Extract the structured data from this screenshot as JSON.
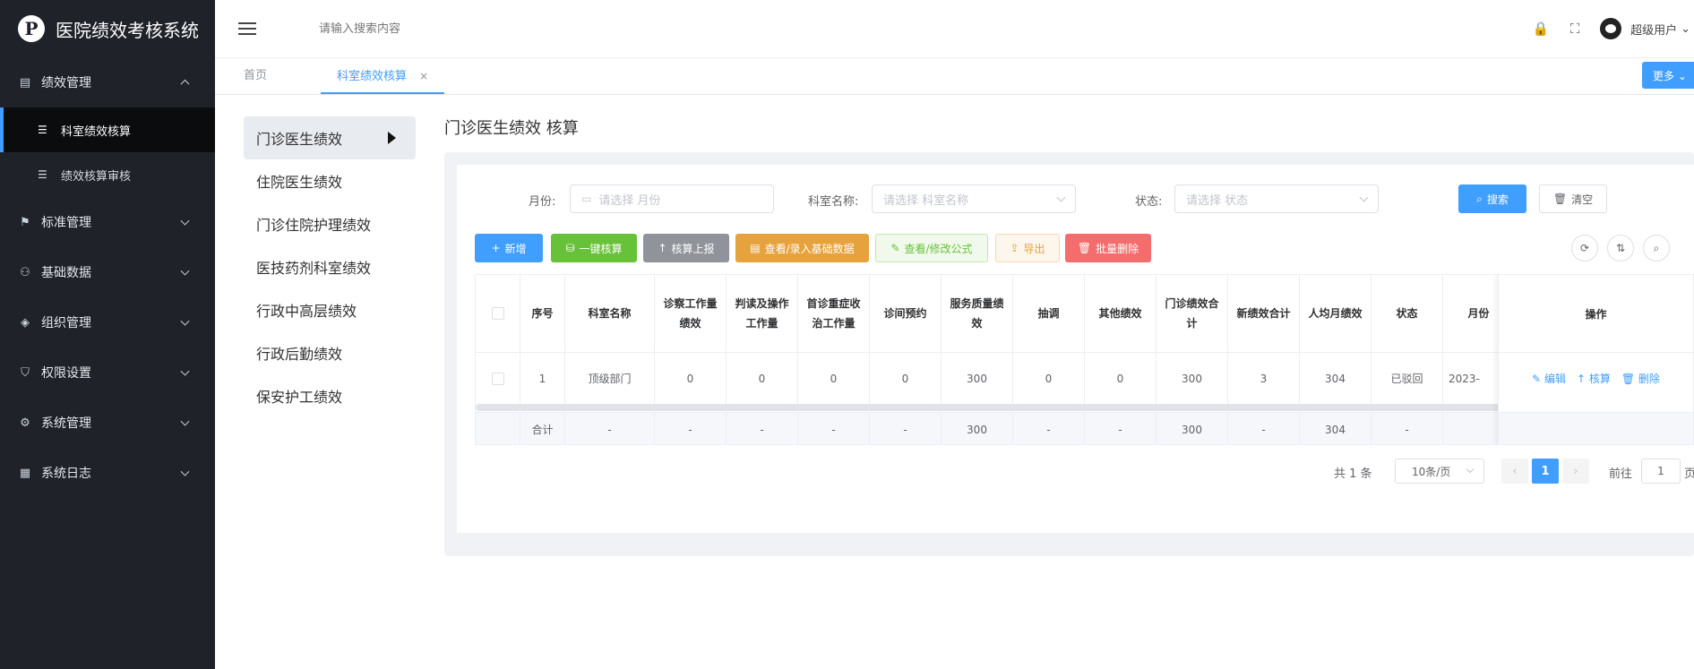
{
  "app": {
    "title": "医院绩效考核系统",
    "logo_glyph": "P"
  },
  "sidebar": {
    "groups": [
      {
        "label": "绩效管理",
        "icon": "document-icon",
        "glyph": "▤",
        "expanded": true,
        "children": [
          {
            "label": "科室绩效核算",
            "glyph": "☰",
            "active": true
          },
          {
            "label": "绩效核算审核",
            "glyph": "☰",
            "active": false
          }
        ]
      },
      {
        "label": "标准管理",
        "icon": "flag-icon",
        "glyph": "⚑"
      },
      {
        "label": "基础数据",
        "icon": "user-icon",
        "glyph": "⚇"
      },
      {
        "label": "组织管理",
        "icon": "tag-icon",
        "glyph": "◈"
      },
      {
        "label": "权限设置",
        "icon": "shield-icon",
        "glyph": "⛉"
      },
      {
        "label": "系统管理",
        "icon": "gear-icon",
        "glyph": "⚙"
      },
      {
        "label": "系统日志",
        "icon": "log-icon",
        "glyph": "▦"
      }
    ]
  },
  "header": {
    "search_placeholder": "请输入搜索内容",
    "lock_glyph": "🔒",
    "fullscreen_glyph": "⛶",
    "username": "超级用户",
    "username_arrow": "⌄"
  },
  "tabs": {
    "items": [
      {
        "label": "首页",
        "active": false
      },
      {
        "label": "科室绩效核算",
        "active": true,
        "close": "×"
      }
    ],
    "more_label": "更多 ⌄"
  },
  "left_nav": {
    "items": [
      "门诊医生绩效",
      "住院医生绩效",
      "门诊住院护理绩效",
      "医技药剂科室绩效",
      "行政中高层绩效",
      "行政后勤绩效",
      "保安护工绩效"
    ]
  },
  "content": {
    "title": "门诊医生绩效 核算"
  },
  "filters": {
    "month_label": "月份:",
    "month_placeholder": "请选择 月份",
    "month_icon": "▭",
    "dept_label": "科室名称:",
    "dept_placeholder": "请选择 科室名称",
    "status_label": "状态:",
    "status_placeholder": "请选择 状态",
    "search_button": "搜索",
    "search_glyph": "⌕",
    "clear_button": "清空",
    "clear_glyph": "🗑"
  },
  "toolbar": {
    "add": {
      "label": "新增",
      "glyph": "+",
      "bg": "#409eff"
    },
    "oneclick": {
      "label": "一键核算",
      "glyph": "⛁",
      "bg": "#67c23a"
    },
    "report": {
      "label": "核算上报",
      "glyph": "↑",
      "bg": "#909399"
    },
    "basic": {
      "label": "查看/录入基础数据",
      "glyph": "▤",
      "bg": "#e6a23c"
    },
    "formula": {
      "label": "查看/修改公式",
      "glyph": "✎"
    },
    "export": {
      "label": "导出",
      "glyph": "⇪"
    },
    "batch_delete": {
      "label": "批量删除",
      "glyph": "🗑",
      "bg": "#f56c6c"
    },
    "refresh_glyph": "⟳",
    "columns_glyph": "⇅",
    "search_glyph": "⌕"
  },
  "table": {
    "headers": [
      "序号",
      "科室名称",
      "诊察工作量绩效",
      "判读及操作工作量",
      "首诊重症收治工作量",
      "诊间预约",
      "服务质量绩效",
      "抽调",
      "其他绩效",
      "门诊绩效合计",
      "新绩效合计",
      "人均月绩效",
      "状态",
      "月份"
    ],
    "rows": [
      [
        "1",
        "顶级部门",
        "0",
        "0",
        "0",
        "0",
        "300",
        "0",
        "0",
        "300",
        "3",
        "304",
        "已驳回",
        "2023-"
      ]
    ],
    "footer": [
      "合计",
      "-",
      "-",
      "-",
      "-",
      "-",
      "300",
      "-",
      "-",
      "300",
      "-",
      "304",
      "-",
      ""
    ],
    "ops_header": "操作",
    "ops": [
      {
        "label": "编辑",
        "glyph": "✎"
      },
      {
        "label": "核算",
        "glyph": "↑"
      },
      {
        "label": "删除",
        "glyph": "🗑"
      }
    ]
  },
  "pagination": {
    "total": "共 1 条",
    "page_size": "10条/页",
    "prev": "‹",
    "current": "1",
    "next": "›",
    "goto_label": "前往",
    "goto_value": "1",
    "goto_suffix": "页"
  },
  "colors": {
    "accent": "#409eff",
    "sidebar_bg": "#1f2329"
  }
}
